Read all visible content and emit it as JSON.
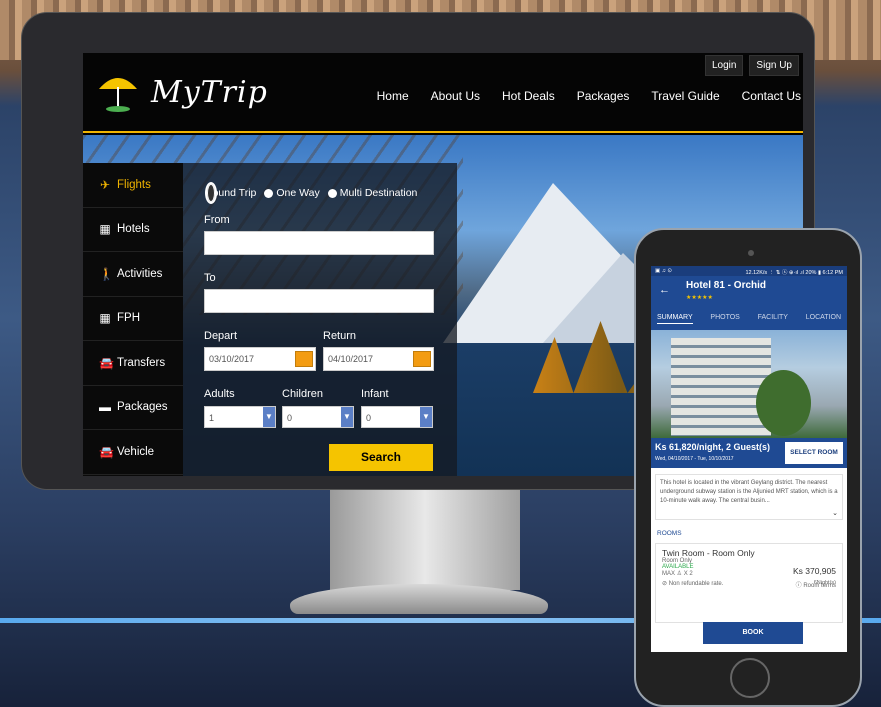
{
  "brand": {
    "name": "MyTrip",
    "accent": "#f0b400"
  },
  "header": {
    "login": "Login",
    "signup": "Sign Up",
    "nav": [
      "Home",
      "About Us",
      "Hot Deals",
      "Packages",
      "Travel Guide",
      "Contact Us"
    ]
  },
  "sidebar": {
    "items": [
      {
        "label": "Flights",
        "icon": "plane-icon",
        "active": true
      },
      {
        "label": "Hotels",
        "icon": "building-icon"
      },
      {
        "label": "Activities",
        "icon": "person-icon"
      },
      {
        "label": "FPH",
        "icon": "building-icon"
      },
      {
        "label": "Transfers",
        "icon": "car-icon"
      },
      {
        "label": "Packages",
        "icon": "ticket-icon"
      },
      {
        "label": "Vehicle",
        "icon": "car-icon"
      }
    ]
  },
  "form": {
    "trip_types": [
      "Round Trip",
      "One Way",
      "Multi Destination"
    ],
    "selected_trip": "Round Trip",
    "from_label": "From",
    "to_label": "To",
    "depart_label": "Depart",
    "return_label": "Return",
    "depart_value": "03/10/2017",
    "return_value": "04/10/2017",
    "adults_label": "Adults",
    "children_label": "Children",
    "infant_label": "Infant",
    "adults_value": "1",
    "children_value": "0",
    "infant_value": "0",
    "search_label": "Search"
  },
  "mobile": {
    "status_left": "▣ ♫ ⊙",
    "status_right": "12.12K/s ⋮ ⇅ ⓢ ⊕·ıl .ıl 20% ▮ 6:12 PM",
    "hotel_name": "Hotel 81 - Orchid",
    "stars": "★★★★★",
    "tabs": [
      "SUMMARY",
      "PHOTOS",
      "FACILITY",
      "LOCATION"
    ],
    "price": "Ks 61,820/night, 2 Guest(s)",
    "dates": "Wed, 04/10/2017 - Tue, 10/10/2017",
    "select_room": "SELECT ROOM",
    "description": "This hotel is located in the vibrant Geylang district. The nearest underground subway station is the Aljunied MRT station, which is a 10-minute walk away. The central busin...",
    "rooms_label": "ROOMS",
    "room_name": "Twin Room - Room Only",
    "room_type": "Room Only",
    "availability": "AVAILABLE",
    "max": "MAX ♙ X 2",
    "room_price": "Ks 370,905",
    "nights": "6Night(s)",
    "non_refundable": "Non refundable rate.",
    "room_terms": "Room terms",
    "book": "BOOK"
  }
}
